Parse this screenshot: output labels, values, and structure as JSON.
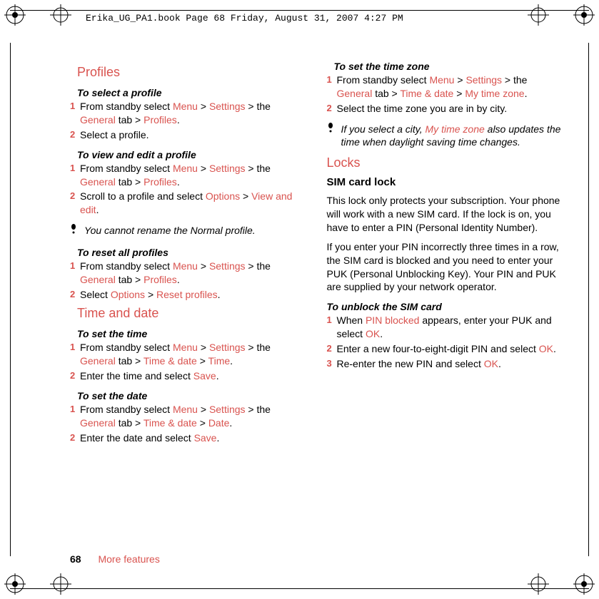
{
  "header": "Erika_UG_PA1.book  Page 68  Friday, August 31, 2007  4:27 PM",
  "footer": {
    "page": "68",
    "section": "More features"
  },
  "left": {
    "h_profiles": "Profiles",
    "p_select": "To select a profile",
    "s1a": "From standby select ",
    "s1m": "Menu",
    "s1gt1": " > ",
    "s1set": "Settings",
    "s1gt2": " > the ",
    "s1gen": "General",
    "s1tab": " tab > ",
    "s1prof": "Profiles",
    "s1dot": ".",
    "s2": "Select a profile.",
    "p_view": "To view and edit a profile",
    "v2a": "Scroll to a profile and select ",
    "v2opt": "Options",
    "v2gt": " > ",
    "v2ve": "View and edit",
    "v2dot": ".",
    "note1": "You cannot rename the Normal profile.",
    "p_reset": "To reset all profiles",
    "r2a": "Select ",
    "r2opt": "Options",
    "r2gt": " > ",
    "r2rp": "Reset profiles",
    "r2dot": ".",
    "h_time": "Time and date",
    "p_settime": "To set the time",
    "t1tab": " tab > ",
    "t1td": "Time & date",
    "t1gt": " > ",
    "t1time": "Time",
    "t1dot": ".",
    "t2a": "Enter the time and select ",
    "t2save": "Save",
    "t2dot": ".",
    "p_setdate": "To set the date",
    "d1date": "Date",
    "d2a": "Enter the date and select "
  },
  "right": {
    "p_zone": "To set the time zone",
    "z1mtz": "My time zone",
    "z2": "Select the time zone you are in by city.",
    "note2a": "If you select a city, ",
    "note2b": "My time zone",
    "note2c": " also updates the time when daylight saving time changes.",
    "h_locks": "Locks",
    "h_sim": "SIM card lock",
    "body1": "This lock only protects your subscription. Your phone will work with a new SIM card. If the lock is on, you have to enter a PIN (Personal Identity Number).",
    "body2": "If you enter your PIN incorrectly three times in a row, the SIM card is blocked and you need to enter your PUK (Personal Unblocking Key). Your PIN and PUK are supplied by your network operator.",
    "p_unblock": "To unblock the SIM card",
    "u1a": "When ",
    "u1pb": "PIN blocked",
    "u1b": " appears, enter your PUK and select ",
    "u1ok": "OK",
    "u1dot": ".",
    "u2a": "Enter a new four-to-eight-digit PIN and select ",
    "u3a": "Re-enter the new PIN and select "
  }
}
